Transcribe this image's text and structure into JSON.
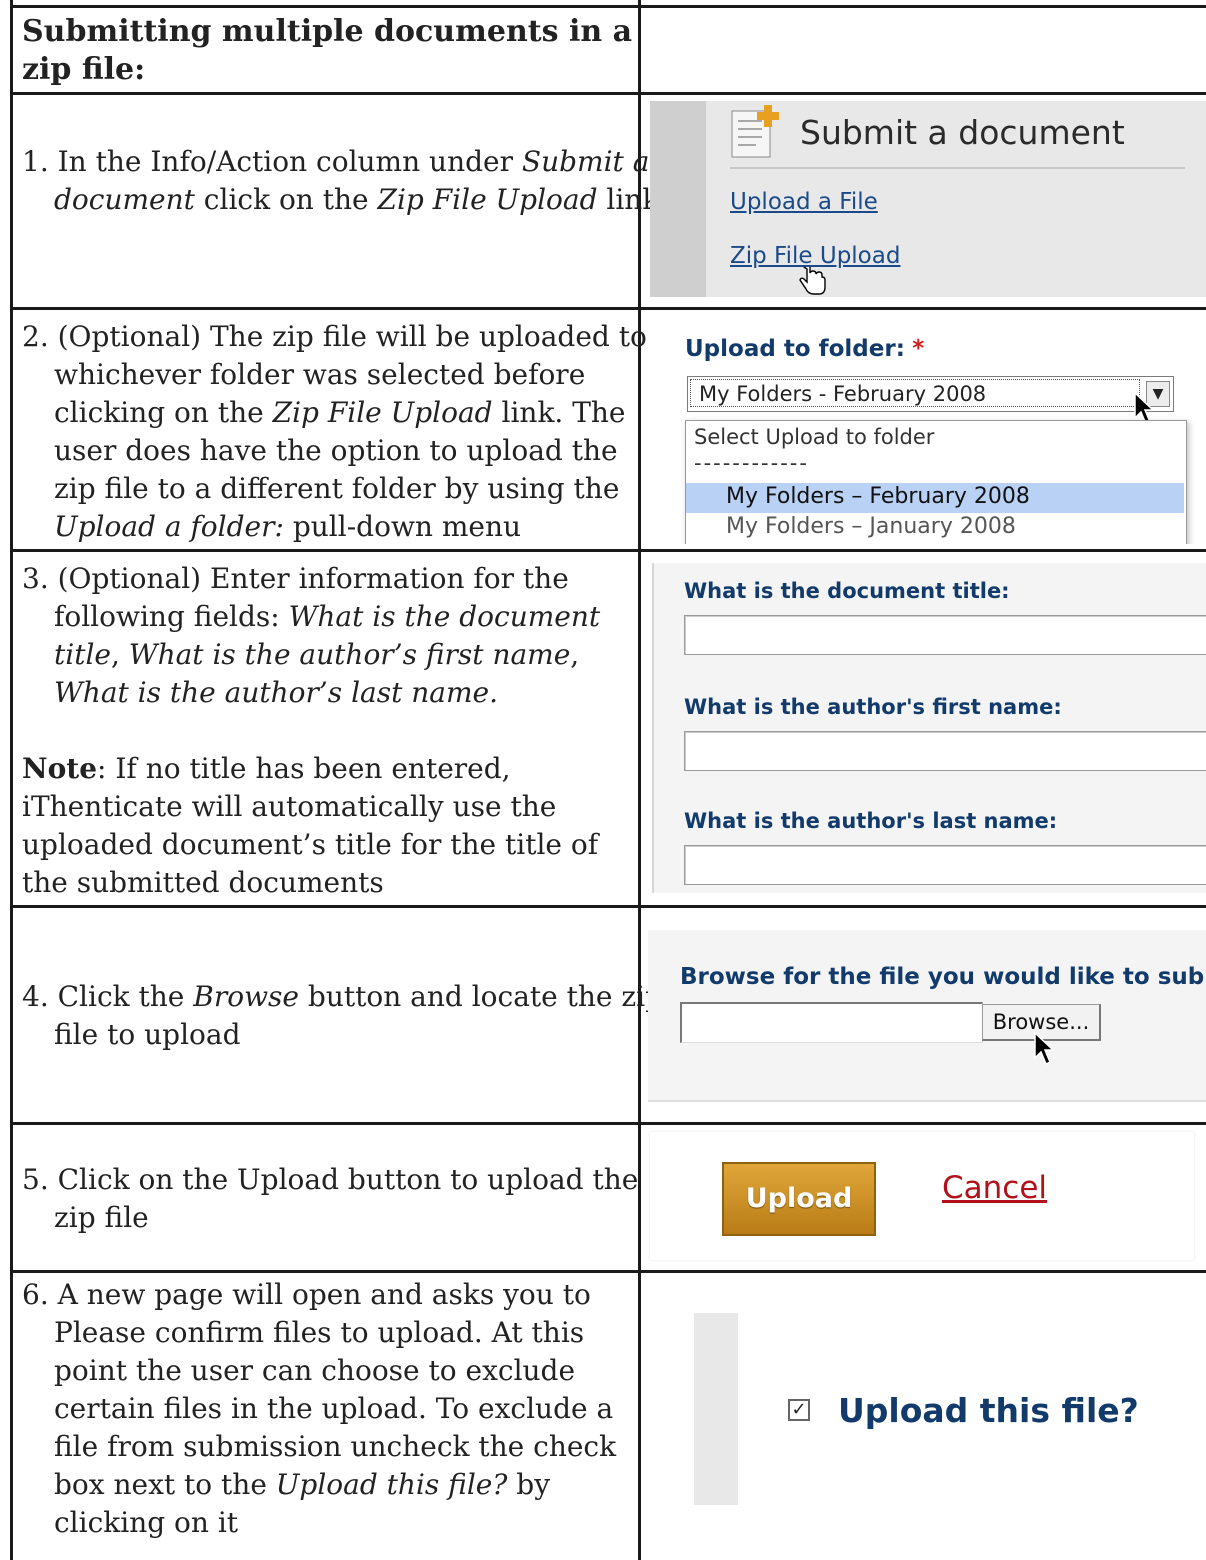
{
  "header": {
    "title": "Submitting multiple documents in a zip file:"
  },
  "steps": [
    {
      "num": "1.",
      "parts": [
        [
          "t",
          "In the Info/Action column under "
        ],
        [
          "i",
          "Submit a document"
        ],
        [
          "t",
          " click on the "
        ],
        [
          "i",
          "Zip File Upload"
        ],
        [
          "t",
          " link"
        ]
      ]
    },
    {
      "num": "2.",
      "parts": [
        [
          "t",
          "(Optional) The zip file will be uploaded to whichever folder was selected before clicking on the "
        ],
        [
          "i",
          "Zip File Upload"
        ],
        [
          "t",
          " link.  The user does have the option to upload the zip file to a different folder by using the "
        ],
        [
          "i",
          "Upload a folder:"
        ],
        [
          "t",
          " pull-down menu"
        ]
      ]
    },
    {
      "num": "3.",
      "parts": [
        [
          "t",
          "(Optional) Enter information for the following fields: "
        ],
        [
          "i",
          "What is the document title"
        ],
        [
          "t",
          ", "
        ],
        [
          "i",
          "What is the author’s first name"
        ],
        [
          "t",
          ", "
        ],
        [
          "i",
          "What is the author’s last name."
        ]
      ]
    },
    {
      "num": "4.",
      "parts": [
        [
          "t",
          "Click the "
        ],
        [
          "i",
          "Browse"
        ],
        [
          "t",
          " button and locate the zip file to upload"
        ]
      ]
    },
    {
      "num": "5.",
      "parts": [
        [
          "t",
          "Click on the Upload button to upload the zip file"
        ]
      ]
    },
    {
      "num": "6.",
      "parts": [
        [
          "t",
          "A new page will open and asks you to Please confirm files to upload. At this point the user can choose to exclude certain files in the upload. To exclude a file from submission uncheck the check box next to the "
        ],
        [
          "i",
          "Upload this file?"
        ],
        [
          "t",
          "  by clicking on it"
        ]
      ]
    }
  ],
  "note": {
    "label": "Note",
    "text": ": If no title has been entered, iThenticate will automatically use the uploaded document’s title for the title of the submitted documents"
  },
  "shot1": {
    "title": "Submit a document",
    "link1": "Upload a File",
    "link2": "Zip File Upload"
  },
  "shot2": {
    "label": "Upload to folder:",
    "required_mark": "*",
    "selected": "My Folders - February 2008",
    "options": [
      "Select Upload to folder",
      "------------",
      "My Folders – February 2008",
      "My Folders – January 2008"
    ]
  },
  "shot3": {
    "labels": [
      "What is the document title:",
      "What is the author's first name:",
      "What is the author's last name:"
    ]
  },
  "shot4": {
    "label": "Browse for the file you would like to subm",
    "button": "Browse..."
  },
  "shot5": {
    "upload": "Upload",
    "cancel": "Cancel"
  },
  "shot6": {
    "label": "Upload this file?",
    "checked": true
  },
  "colors": {
    "link": "#1a4a8a",
    "label_blue": "#123b6b",
    "upload_btn": "#c98a1e",
    "cancel_red": "#b2101a",
    "selected_option": "#b9d1f5"
  }
}
